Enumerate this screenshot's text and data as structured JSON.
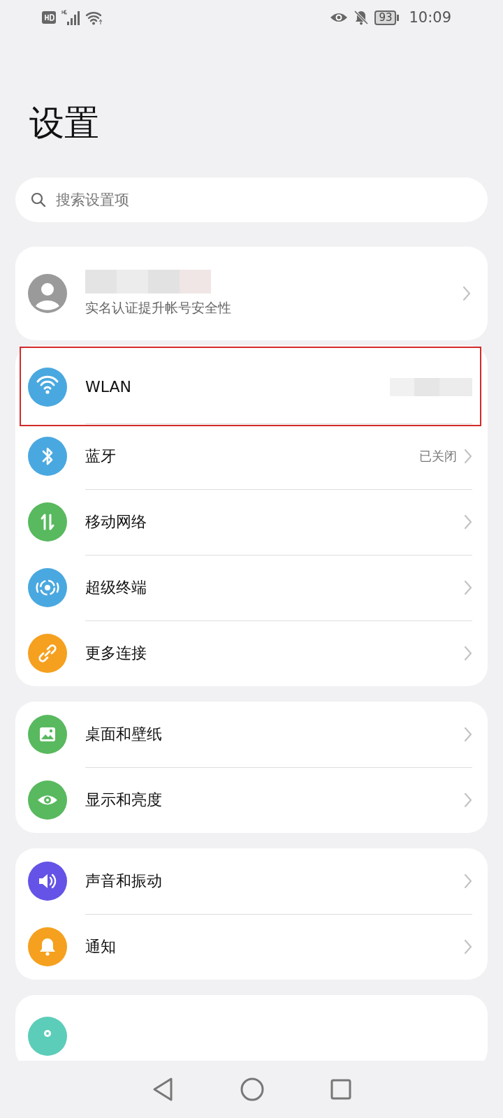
{
  "status_bar": {
    "battery": "93",
    "time": "10:09",
    "notifications_muted": true
  },
  "title": "设置",
  "search": {
    "placeholder": "搜索设置项"
  },
  "account": {
    "name_masked": true,
    "subtitle": "实名认证提升帐号安全性"
  },
  "groups": [
    {
      "rows": [
        {
          "label": "WLAN",
          "color": "#4aa8e0",
          "value_masked": true,
          "highlighted": true
        },
        {
          "label": "蓝牙",
          "color": "#4aa8e0",
          "value": "已关闭",
          "highlighted": false
        },
        {
          "label": "移动网络",
          "color": "#58b95e",
          "highlighted": false
        },
        {
          "label": "超级终端",
          "color": "#4aa8e0",
          "highlighted": false
        },
        {
          "label": "更多连接",
          "color": "#f5a01e",
          "highlighted": false
        }
      ]
    },
    {
      "rows": [
        {
          "label": "桌面和壁纸",
          "color": "#58b95e",
          "highlighted": false
        },
        {
          "label": "显示和亮度",
          "color": "#58b95e",
          "highlighted": false
        }
      ]
    },
    {
      "rows": [
        {
          "label": "声音和振动",
          "color": "#6453e6",
          "highlighted": false
        },
        {
          "label": "通知",
          "color": "#f5a01e",
          "highlighted": false
        }
      ]
    },
    {
      "rows": [
        {
          "color": "#5ccdb8",
          "highlighted": false
        }
      ]
    }
  ]
}
